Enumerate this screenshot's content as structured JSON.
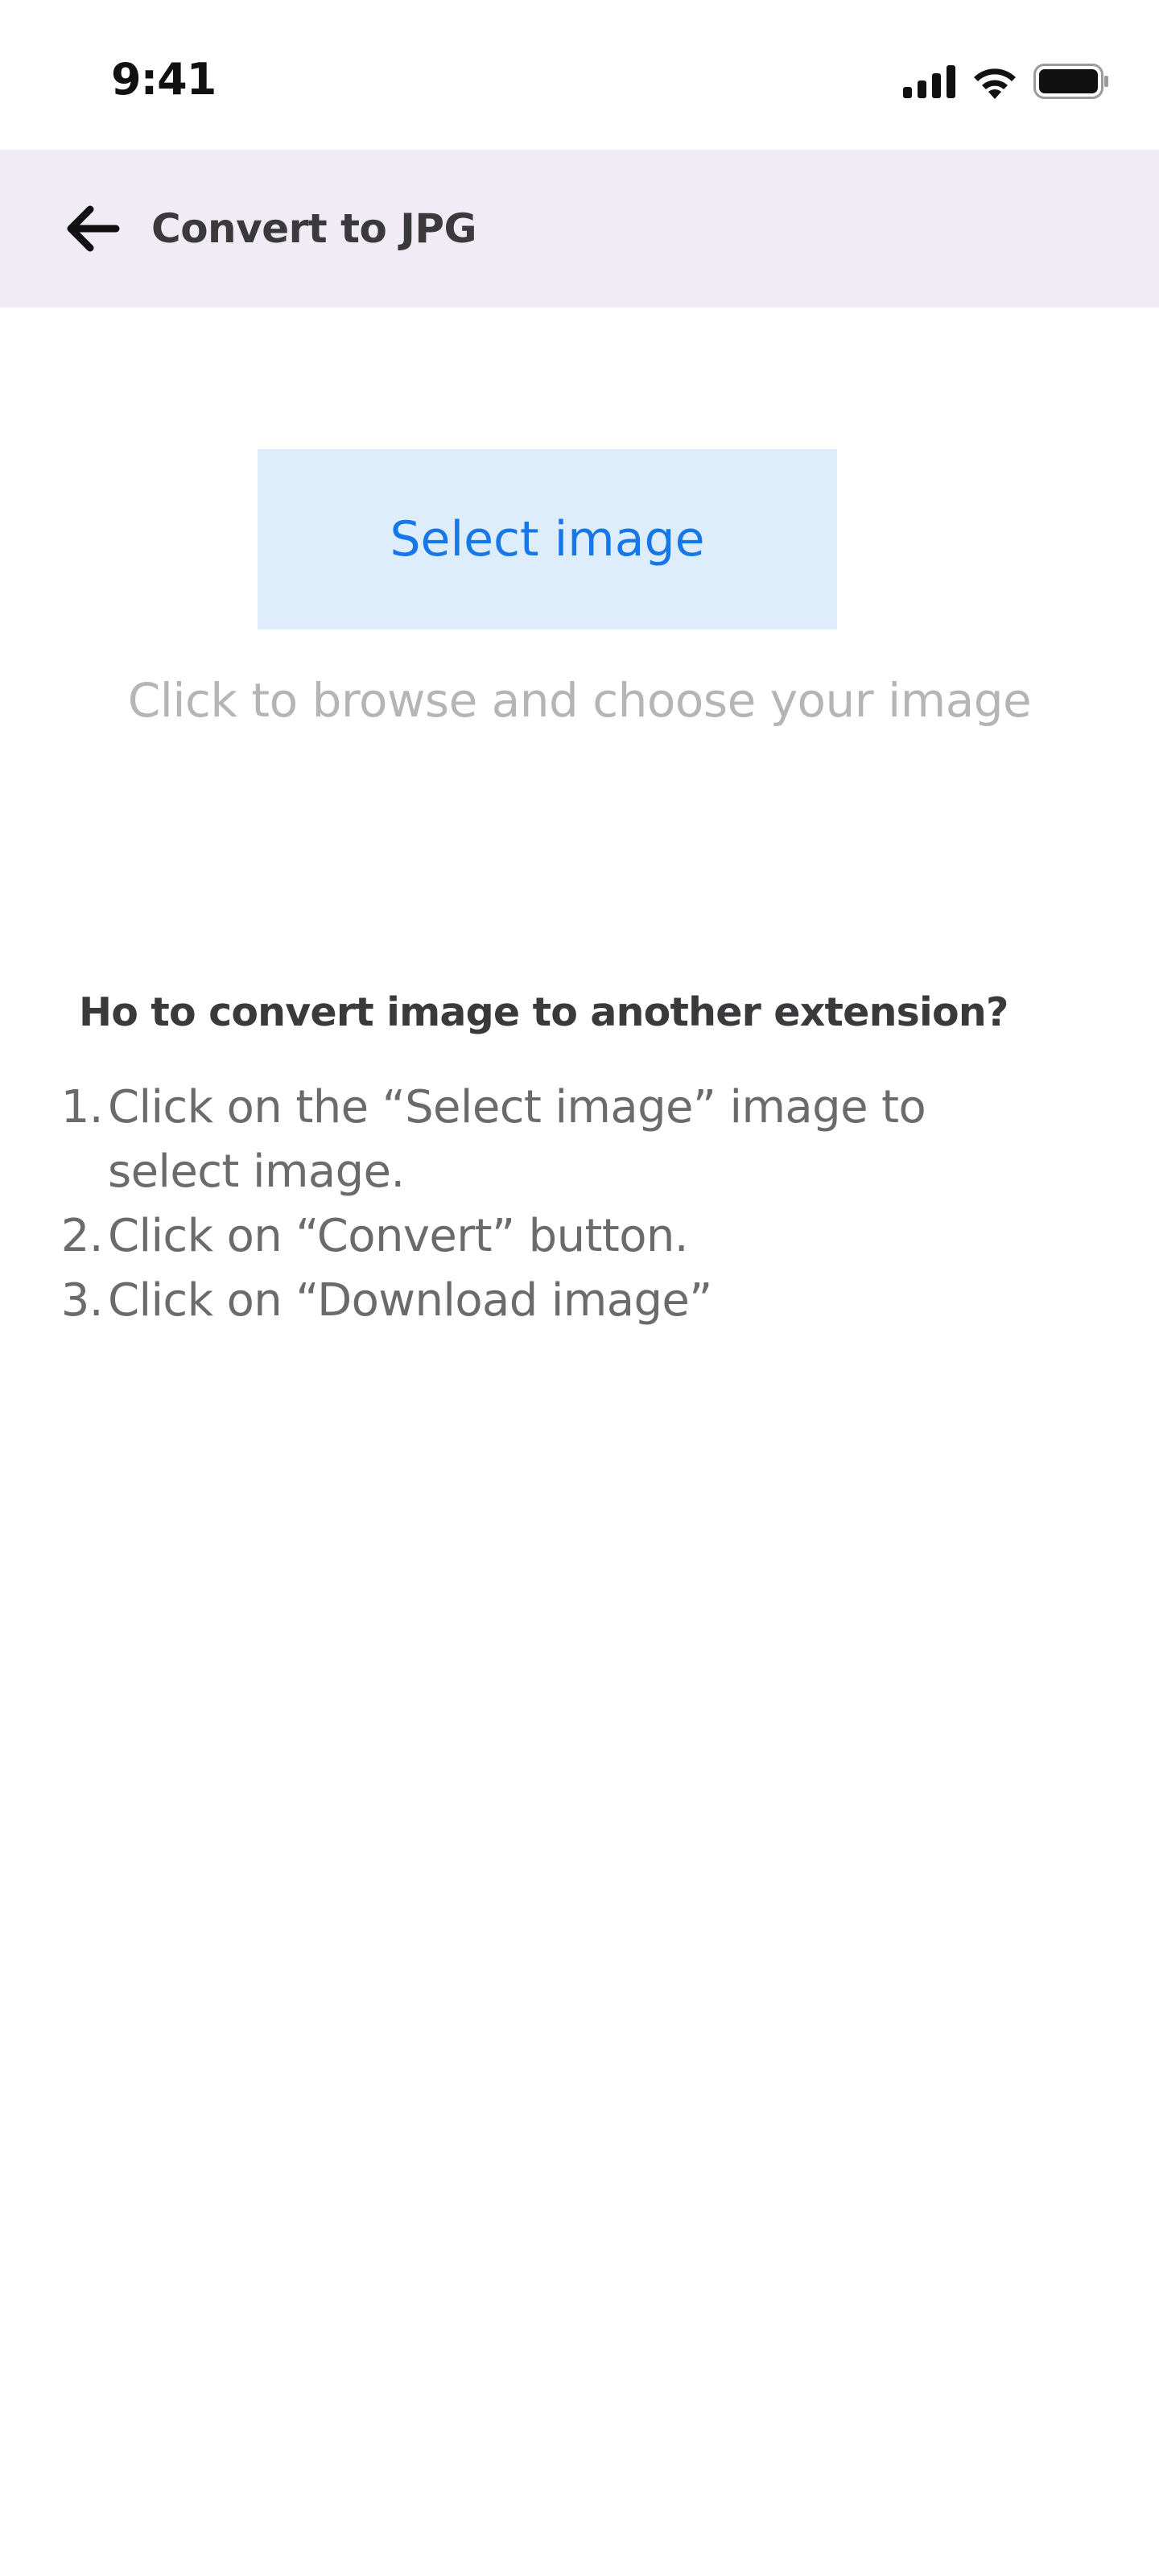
{
  "status_bar": {
    "time": "9:41",
    "icons": [
      "cellular-signal-icon",
      "wifi-icon",
      "battery-icon"
    ]
  },
  "app_bar": {
    "back_icon": "arrow-left-icon",
    "title": "Convert to JPG",
    "background": "#f1ebf6"
  },
  "upload": {
    "button_label": "Select image",
    "hint": "Click to browse and choose your image",
    "button_background": "#ddedfb",
    "accent": "#1877e8"
  },
  "instructions": {
    "title": "Ho to convert image to another extension?",
    "steps": [
      {
        "number": "1.",
        "text": "Click on the “Select image” image to select image."
      },
      {
        "number": "2.",
        "text": "Click on “Convert” button."
      },
      {
        "number": "3.",
        "text": "Click on “Download image”"
      }
    ]
  }
}
